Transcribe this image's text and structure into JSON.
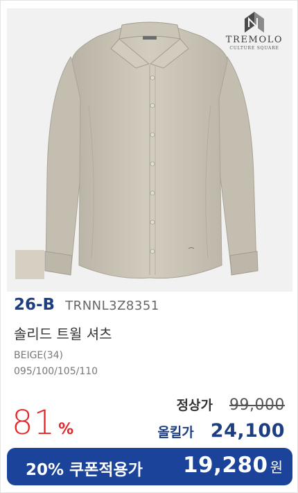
{
  "brand": {
    "name": "TREMOLO",
    "tagline": "CULTURE SQUARE"
  },
  "product": {
    "color_code": "26-B",
    "style_code": "TRNNL3Z8351",
    "name": "솔리드 트윌 셔츠",
    "color_name": "BEIGE(34)",
    "sizes": "095/100/105/110"
  },
  "pricing": {
    "discount_number": "81",
    "discount_unit": "%",
    "regular_label": "정상가",
    "regular_price": "99,000",
    "sale_label": "올킬가",
    "sale_price": "24,100"
  },
  "coupon": {
    "label": "20% 쿠폰적용가",
    "price": "19,280",
    "unit": "원"
  },
  "colors": {
    "accent_blue": "#1d3f82",
    "coupon_bg": "#1a4399",
    "discount_red": "#e52628",
    "swatch": "#d6d0c3"
  }
}
